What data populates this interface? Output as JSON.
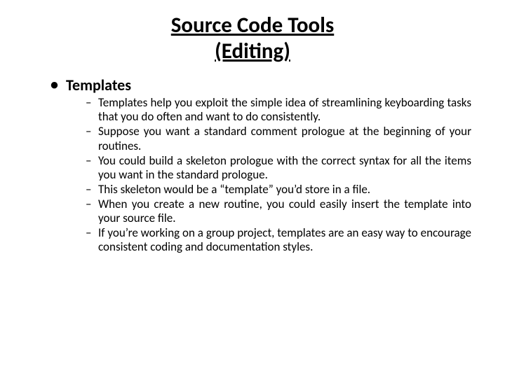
{
  "title_line1": "Source Code Tools",
  "title_line2": "(Editing)",
  "section": "Templates",
  "points": [
    "Templates help you exploit the simple idea of streamlining keyboarding tasks that you do often and want to do consistently.",
    "Suppose you want a standard comment prologue at the beginning of your routines.",
    "You could build a skeleton prologue with the correct syntax for all the items you want in the standard prologue.",
    "This skeleton would be a “template” you’d store in a file.",
    "When you create a new routine, you could easily insert the template into your source file.",
    "If you’re working on a group project, templates are an easy way to encourage consistent coding and documentation styles."
  ]
}
